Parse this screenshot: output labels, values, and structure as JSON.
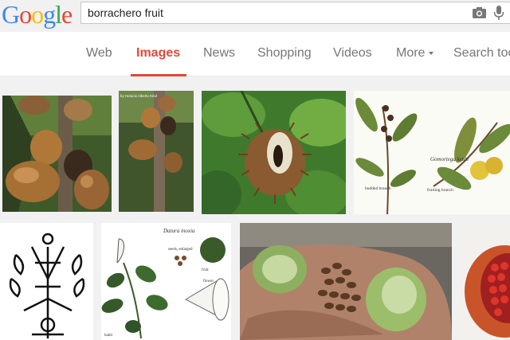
{
  "logo": {
    "text": "Google"
  },
  "search": {
    "query": "borrachero fruit"
  },
  "nav": {
    "tabs": [
      {
        "label": "Web"
      },
      {
        "label": "Images"
      },
      {
        "label": "News"
      },
      {
        "label": "Shopping"
      },
      {
        "label": "Videos"
      },
      {
        "label": "More"
      },
      {
        "label": "Search tools"
      }
    ]
  },
  "results": {
    "images": [
      {
        "title": ""
      },
      {
        "title": ""
      },
      {
        "title": ""
      },
      {
        "title": ""
      },
      {
        "title": ""
      },
      {
        "title": ""
      },
      {
        "title": ""
      },
      {
        "title": ""
      }
    ],
    "labels": {
      "botanical_species": "Gomortega keule",
      "budded_branch": "budded branch",
      "fruiting_branch": "fruiting branch",
      "datura_title": "Datura inoxia",
      "datura_seeds": "seeds, enlarged",
      "datura_fruit": "fruit",
      "datura_flower": "flower",
      "datura_habit": "habit",
      "photo_credit": "by Horacio Alberto Kind"
    }
  },
  "colors": {
    "logo_blue": "#4285f4",
    "logo_red": "#ea4335",
    "logo_yellow": "#fbbc05",
    "logo_green": "#34a853",
    "active_tab": "#dd4b39",
    "inactive_tab": "#777777"
  }
}
